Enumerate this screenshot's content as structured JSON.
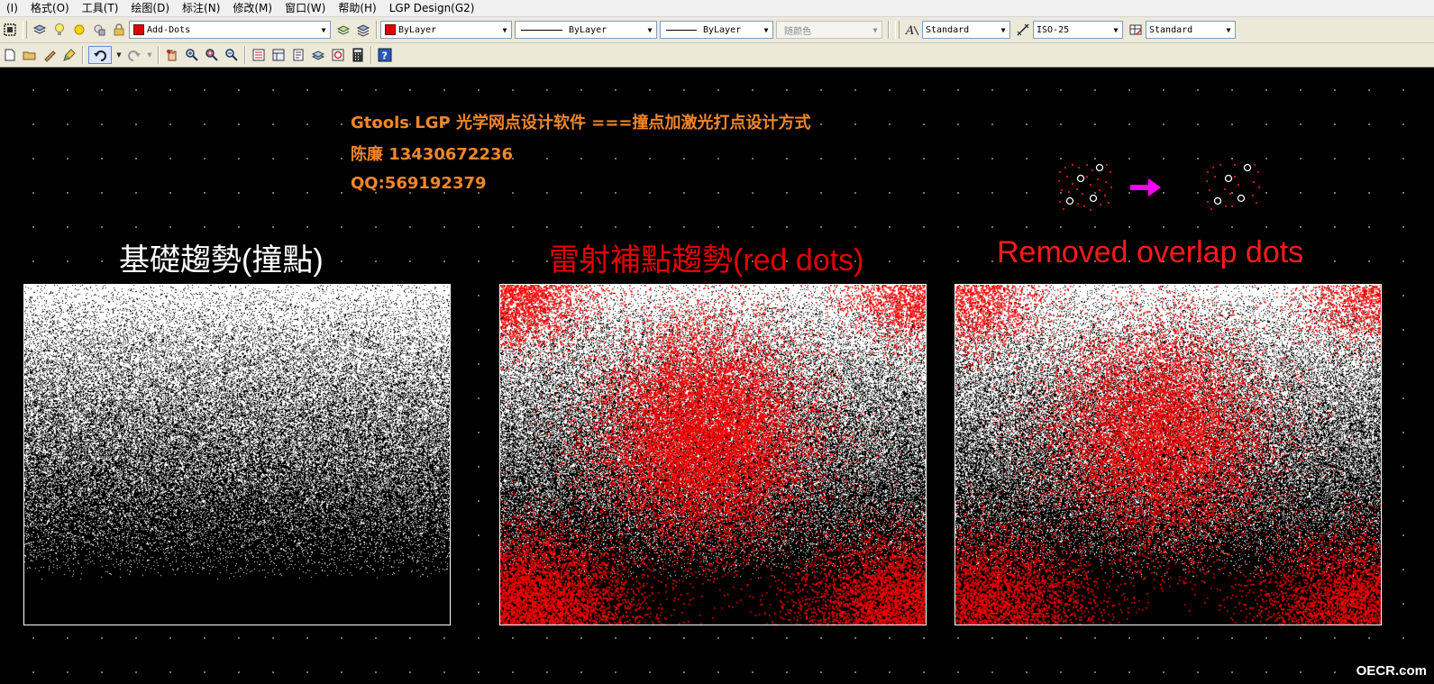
{
  "menu": [
    "(I)",
    "格式(O)",
    "工具(T)",
    "绘图(D)",
    "标注(N)",
    "修改(M)",
    "窗口(W)",
    "帮助(H)",
    "LGP Design(G2)"
  ],
  "toolbar": {
    "layer_name": "Add-Dots",
    "color": "ByLayer",
    "linetype": "ByLayer",
    "lineweight": "ByLayer",
    "plotstyle": "随颜色",
    "text_style": "Standard",
    "dim_style": "ISO-25",
    "table_style": "Standard"
  },
  "header": {
    "line1": "Gtools LGP 光学网点设计软件 ===撞点加激光打点设计方式",
    "line2": "陈廉  13430672236",
    "line3": "QQ:569192379"
  },
  "panels": [
    {
      "title": "基礎趨勢(撞點)",
      "title_color": "#ffffff"
    },
    {
      "title": "雷射補點趨勢(red dots)",
      "title_color": "#e60000"
    },
    {
      "title": "Removed overlap dots",
      "title_color": "#ff1a1a"
    }
  ],
  "colors": {
    "accent_header": "#f0872a",
    "red_dots": "#ff0000",
    "arrow": "#ff00ff"
  },
  "watermark": "OECR.com"
}
